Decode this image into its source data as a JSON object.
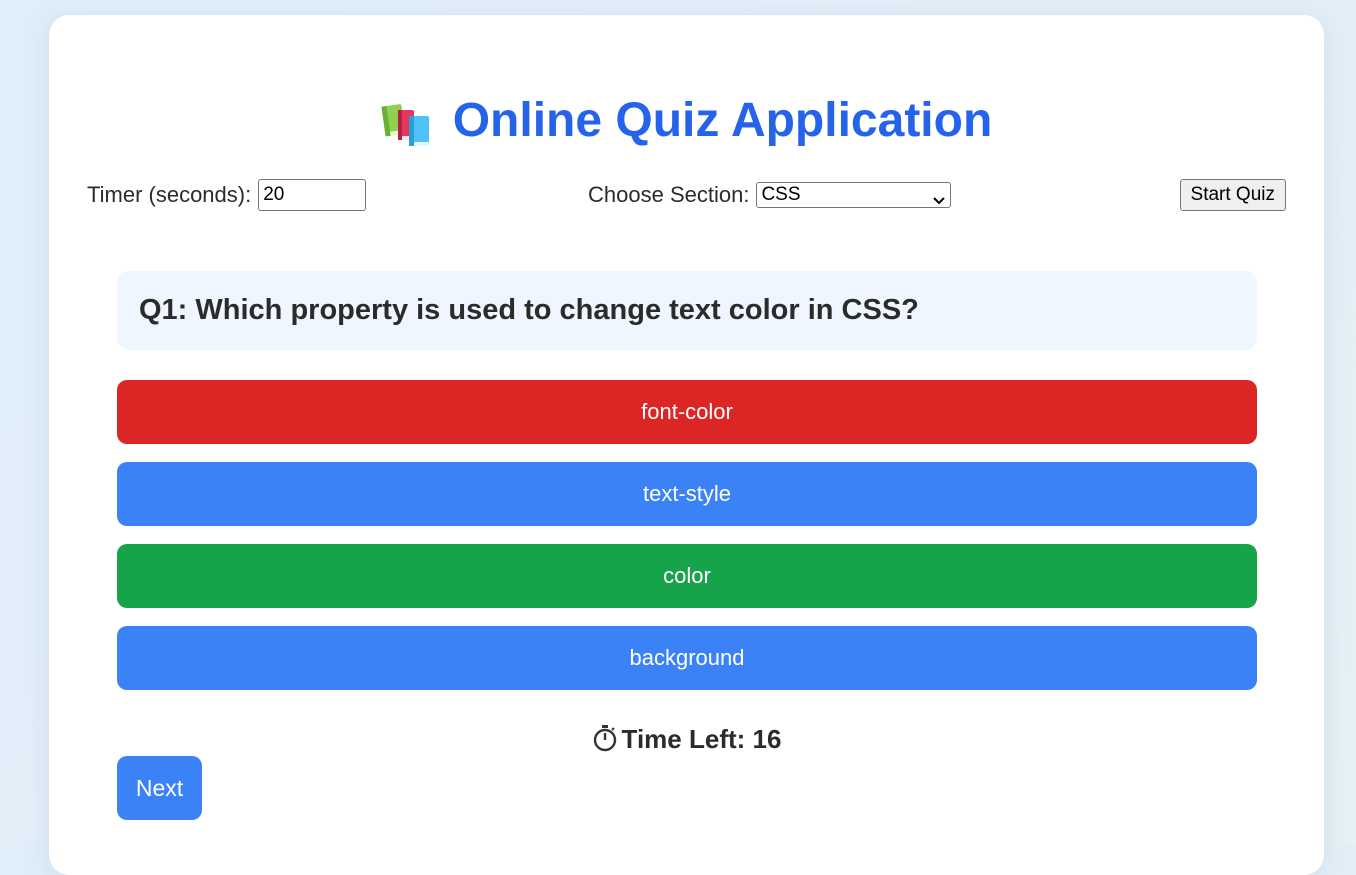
{
  "app": {
    "title": "Online Quiz Application",
    "title_icon": "books-icon",
    "accent_color": "#2563eb"
  },
  "controls": {
    "timer_label": "Timer (seconds):",
    "timer_value": "20",
    "section_label": "Choose Section:",
    "section_selected": "CSS",
    "start_label": "Start Quiz"
  },
  "question": {
    "text": "Q1: Which property is used to change text color in CSS?"
  },
  "options": [
    {
      "label": "font-color",
      "state": "wrong",
      "color": "#dc2626"
    },
    {
      "label": "text-style",
      "state": "default",
      "color": "#3b82f6"
    },
    {
      "label": "color",
      "state": "correct",
      "color": "#16a34a"
    },
    {
      "label": "background",
      "state": "default",
      "color": "#3b82f6"
    }
  ],
  "timer": {
    "icon": "stopwatch-icon",
    "label": "Time Left: 16"
  },
  "next_label": "Next"
}
